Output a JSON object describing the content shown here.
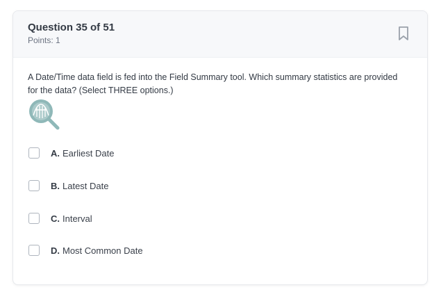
{
  "question": {
    "title": "Question 35 of 51",
    "points": "Points: 1",
    "prompt": "A Date/Time data field is fed into the Field Summary tool. Which summary statistics are provided for the data? (Select THREE options.)",
    "icon": "field-summary-tool-icon",
    "bookmark_icon": "bookmark-icon"
  },
  "options": [
    {
      "letter": "A.",
      "text": "Earliest Date",
      "checked": false
    },
    {
      "letter": "B.",
      "text": "Latest Date",
      "checked": false
    },
    {
      "letter": "C.",
      "text": "Interval",
      "checked": false
    },
    {
      "letter": "D.",
      "text": "Most Common Date",
      "checked": false
    }
  ],
  "colors": {
    "icon_teal": "#8fb8b8",
    "checkbox_border": "#aeb4bd",
    "title_text": "#333a44"
  }
}
